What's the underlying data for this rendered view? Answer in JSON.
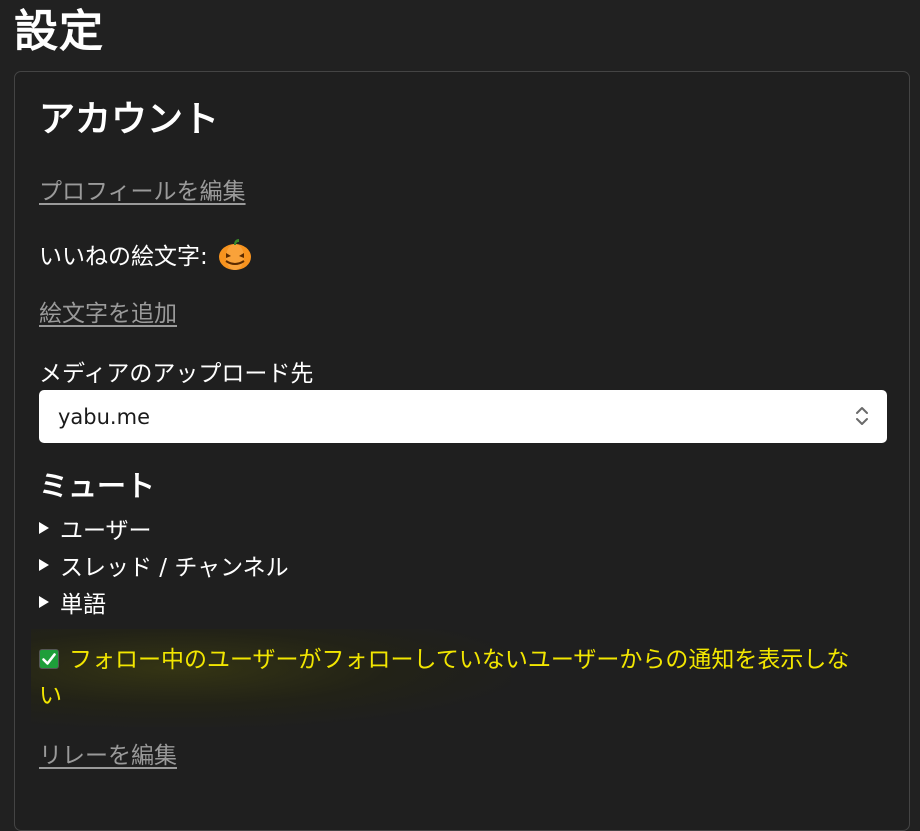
{
  "page": {
    "title": "設定"
  },
  "account": {
    "title": "アカウント",
    "edit_profile_link": "プロフィールを編集",
    "reaction_emoji_label": "いいねの絵文字:",
    "reaction_emoji_icon": "jack-o-lantern-icon",
    "add_emoji_link": "絵文字を追加",
    "media_upload_label": "メディアのアップロード先",
    "media_upload_selected": "yabu.me"
  },
  "mute": {
    "title": "ミュート",
    "items": [
      {
        "label": "ユーザー"
      },
      {
        "label": "スレッド / チャンネル"
      },
      {
        "label": "単語"
      }
    ]
  },
  "notification_filter": {
    "checked": true,
    "label_line1": "フォロー中のユーザーがフォローしていないユーザーからの通知を表示しな",
    "label_line2": "い",
    "text_color": "#f2e600",
    "checkbox_color": "#1e9e3a"
  },
  "relays": {
    "edit_relays_link": "リレーを編集"
  }
}
